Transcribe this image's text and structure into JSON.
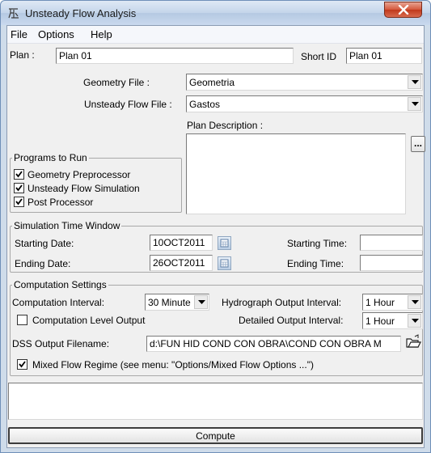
{
  "window": {
    "title": "Unsteady Flow Analysis"
  },
  "menu": {
    "items": [
      "File",
      "Options",
      "Help"
    ]
  },
  "plan": {
    "label": "Plan :",
    "value": "Plan 01",
    "short_id_label": "Short ID",
    "short_id_value": "Plan 01"
  },
  "geometry": {
    "label": "Geometry File :",
    "value": "Geometria"
  },
  "unsteady": {
    "label": "Unsteady Flow File :",
    "value": "Gastos"
  },
  "programs": {
    "title": "Programs to Run",
    "items": [
      {
        "label": "Geometry Preprocessor",
        "checked": true
      },
      {
        "label": "Unsteady Flow Simulation",
        "checked": true
      },
      {
        "label": "Post Processor",
        "checked": true
      }
    ]
  },
  "description": {
    "label": "Plan Description :",
    "value": "",
    "browse_label": "..."
  },
  "sim_window": {
    "title": "Simulation Time Window",
    "start_date_label": "Starting Date:",
    "start_date": "10OCT2011",
    "end_date_label": "Ending Date:",
    "end_date": "26OCT2011",
    "start_time_label": "Starting Time:",
    "start_time": "",
    "end_time_label": "Ending Time:",
    "end_time": ""
  },
  "computation": {
    "title": "Computation Settings",
    "interval_label": "Computation Interval:",
    "interval_value": "30 Minute",
    "hydro_label": "Hydrograph Output Interval:",
    "hydro_value": "1 Hour",
    "level_output_label": "Computation Level Output",
    "level_output_checked": false,
    "detailed_label": "Detailed Output Interval:",
    "detailed_value": "1 Hour",
    "dss_label": "DSS Output Filename:",
    "dss_value": "d:\\FUN HID COND CON OBRA\\COND CON OBRA M",
    "mixed_label": "Mixed Flow Regime (see menu: \"Options/Mixed Flow Options ...\")",
    "mixed_checked": true
  },
  "status": {
    "text": ""
  },
  "compute": {
    "label": "Compute"
  }
}
